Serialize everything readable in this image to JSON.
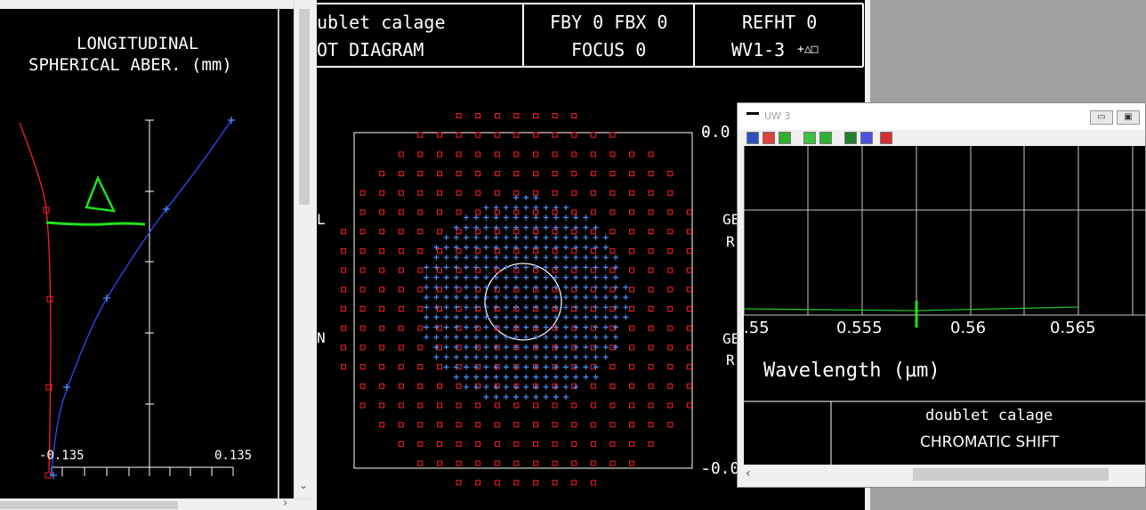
{
  "left_window": {
    "title_line1": "LONGITUDINAL",
    "title_line2": "SPHERICAL ABER. (mm)",
    "x_min_label": "-0.135",
    "x_max_label": "0.135",
    "annotation": "Δ",
    "scroll_right_arrow": "›",
    "scroll_down_arrow": "⌄"
  },
  "mid_window": {
    "header_left_line1": "ublet calage",
    "header_left_line2": "OT DIAGRAM",
    "header_mid_line1": "FBY 0 FBX 0",
    "header_mid_line2": "FOCUS 0",
    "header_right_line1": "REFHT 0",
    "header_right_line2": "WV1-3",
    "header_right_symbols": "+△□",
    "scale_top": "0.0",
    "scale_bottom": "-0.0",
    "side_label_1": "GE",
    "side_label_2": "R",
    "side_label_3": "GE",
    "side_label_4": "R",
    "left_cut_1": "L",
    "left_cut_2": "N"
  },
  "uw_window": {
    "title": "UW 3",
    "minimize": "▭",
    "maximize": "▣",
    "tick_labels": [
      ".55",
      "0.555",
      "0.56",
      "0.565"
    ],
    "xlabel": "Wavelength (µm)",
    "footer_title": "doublet calage",
    "footer_subtitle": "CHROMATIC SHIFT",
    "scroll_left_arrow": "‹",
    "toolbar_icons": [
      "layers-icon",
      "cross-icon",
      "plus-icon",
      "grid-icon",
      "plus-icon",
      "dash-icon",
      "paint-icon",
      "grid-icon"
    ]
  },
  "colors": {
    "plot_bg": "#000000",
    "red": "#ff2020",
    "blue": "#4a90ff",
    "green": "#20e020",
    "white": "#ffffff"
  }
}
